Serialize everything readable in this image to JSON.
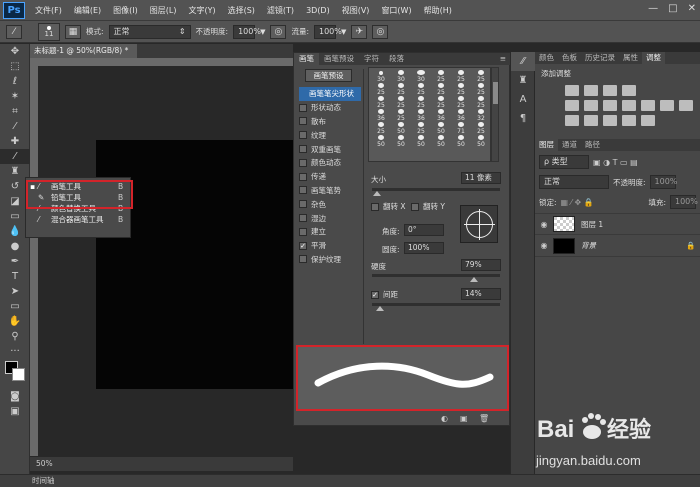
{
  "app": {
    "logo": "Ps"
  },
  "menubar": {
    "items": [
      "文件(F)",
      "编辑(E)",
      "图像(I)",
      "图层(L)",
      "文字(Y)",
      "选择(S)",
      "滤镜(T)",
      "3D(D)",
      "视图(V)",
      "窗口(W)",
      "帮助(H)"
    ],
    "window_controls": [
      "—",
      "□",
      "✕"
    ]
  },
  "options": {
    "brush_size": "11",
    "mode_label": "模式:",
    "mode_value": "正常",
    "opacity_label": "不透明度:",
    "opacity_value": "100%",
    "flow_label": "流量:",
    "flow_value": "100%"
  },
  "document": {
    "tab_title": "未标题-1 @ 50%(RGB/8) *",
    "zoom": "50%",
    "timeline_label": "时间轴"
  },
  "flyout": {
    "items": [
      {
        "label": "画笔工具",
        "key": "B",
        "active": true
      },
      {
        "label": "铅笔工具",
        "key": "B",
        "active": false
      },
      {
        "label": "颜色替换工具",
        "key": "B",
        "active": false
      },
      {
        "label": "混合器画笔工具",
        "key": "B",
        "active": false
      }
    ]
  },
  "brush_panel": {
    "tabs": [
      "画笔",
      "画笔预设",
      "字符",
      "段落"
    ],
    "preset_button": "画笔预设",
    "options": [
      {
        "label": "画笔笔尖形状",
        "checkbox": false,
        "checked": false,
        "selected": true
      },
      {
        "label": "形状动态",
        "checkbox": true,
        "checked": false,
        "selected": false
      },
      {
        "label": "散布",
        "checkbox": true,
        "checked": false,
        "selected": false
      },
      {
        "label": "纹理",
        "checkbox": true,
        "checked": false,
        "selected": false
      },
      {
        "label": "双重画笔",
        "checkbox": true,
        "checked": false,
        "selected": false
      },
      {
        "label": "颜色动态",
        "checkbox": true,
        "checked": false,
        "selected": false
      },
      {
        "label": "传递",
        "checkbox": true,
        "checked": false,
        "selected": false
      },
      {
        "label": "画笔笔势",
        "checkbox": true,
        "checked": false,
        "selected": false
      },
      {
        "label": "杂色",
        "checkbox": true,
        "checked": false,
        "selected": false
      },
      {
        "label": "湿边",
        "checkbox": true,
        "checked": false,
        "selected": false
      },
      {
        "label": "建立",
        "checkbox": true,
        "checked": false,
        "selected": false
      },
      {
        "label": "平滑",
        "checkbox": true,
        "checked": true,
        "selected": false
      },
      {
        "label": "保护纹理",
        "checkbox": true,
        "checked": false,
        "selected": false
      }
    ],
    "tips": [
      "30",
      "30",
      "30",
      "25",
      "25",
      "25",
      "25",
      "25",
      "25",
      "25",
      "25",
      "25",
      "25",
      "25",
      "25",
      "25",
      "25",
      "25",
      "36",
      "25",
      "36",
      "36",
      "36",
      "32",
      "25",
      "50",
      "25",
      "50",
      "71",
      "25",
      "50",
      "50",
      "50",
      "50",
      "50",
      "50"
    ],
    "size_label": "大小",
    "size_value": "11 像素",
    "flip_x": "翻转 X",
    "flip_y": "翻转 Y",
    "angle_label": "角度:",
    "angle_value": "0°",
    "roundness_label": "圆度:",
    "roundness_value": "100%",
    "hardness_label": "硬度",
    "hardness_value": "79%",
    "spacing_label": "间距",
    "spacing_value": "14%"
  },
  "adjustments_panel": {
    "tabs": [
      "颜色",
      "色板",
      "历史记录",
      "属性",
      "调整"
    ],
    "title": "添加调整"
  },
  "layers_panel": {
    "tabs": [
      "图层",
      "通道",
      "路径"
    ],
    "kind_filter": "ρ 类型",
    "blend_mode": "正常",
    "opacity_label": "不透明度:",
    "opacity_value": "100%",
    "lock_label": "锁定:",
    "fill_label": "填充:",
    "fill_value": "100%",
    "layers": [
      {
        "name": "图层 1",
        "type": "transparent"
      },
      {
        "name": "背景",
        "type": "black",
        "locked": true
      }
    ]
  },
  "watermark": {
    "brand": "Bai du 经验",
    "url": "jingyan.baidu.com"
  },
  "colors": {
    "accent": "#d3242a",
    "selection": "#2f6aa9",
    "ps_blue": "#4aa3ff"
  }
}
